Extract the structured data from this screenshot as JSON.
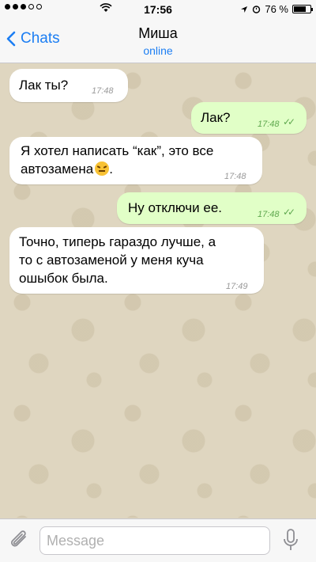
{
  "status_bar": {
    "time": "17:56",
    "battery": "76 %",
    "battery_fraction": 0.76
  },
  "header": {
    "back_label": "Chats",
    "contact_name": "Миша",
    "contact_status": "online"
  },
  "messages": [
    {
      "direction": "in",
      "text": "Лак ты?",
      "time": "17:48"
    },
    {
      "direction": "out",
      "text": "Лак?",
      "time": "17:48",
      "read": true
    },
    {
      "direction": "in",
      "text_line1": "Я хотел написать “как”, это все",
      "text_line2": "автозамена",
      "text_suffix": ".",
      "emoji": "confounded-face",
      "time": "17:48"
    },
    {
      "direction": "out",
      "text": "Ну отключи ее.",
      "time": "17:48",
      "read": true
    },
    {
      "direction": "in",
      "text_line1": "Точно, типерь гараздо лучше, а",
      "text_line2": "то с автозаменой у меня куча",
      "text_line3": "ошыбок была.",
      "time": "17:49"
    }
  ],
  "input": {
    "placeholder": "Message"
  },
  "icons": {
    "attach": "paperclip-icon",
    "mic": "microphone-icon",
    "back": "chevron-left-icon"
  },
  "colors": {
    "accent": "#1c7ef3",
    "outgoing_bubble": "#e1ffc7",
    "incoming_bubble": "#ffffff",
    "chat_background": "#dfd6c0"
  }
}
